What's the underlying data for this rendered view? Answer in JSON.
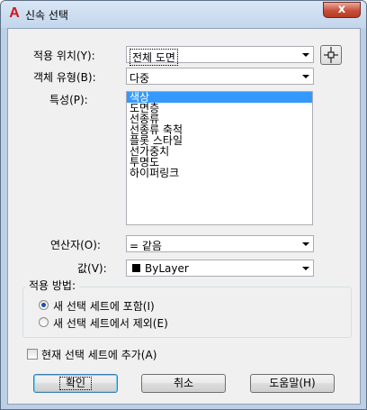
{
  "window": {
    "title": "신속 선택",
    "app_icon": "A",
    "close_label": "x"
  },
  "apply_to": {
    "label": "적용 위치(Y):",
    "value": "전체 도면"
  },
  "object_type": {
    "label": "객체 유형(B):",
    "value": "다중"
  },
  "properties": {
    "label": "특성(P):",
    "items": [
      "색상",
      "도면층",
      "선종류",
      "선종류 축척",
      "플롯 스타일",
      "선가중치",
      "투명도",
      "하이퍼링크"
    ],
    "selected_index": 0
  },
  "operator": {
    "label": "연산자(O):",
    "value": "= 같음"
  },
  "value": {
    "label": "값(V):",
    "value": "ByLayer",
    "swatch_color": "#000000"
  },
  "apply_method": {
    "title": "적용 방법:",
    "include": {
      "label": "새 선택 세트에 포함(I)",
      "checked": true
    },
    "exclude": {
      "label": "새 선택 세트에서 제외(E)",
      "checked": false
    }
  },
  "append": {
    "label": "현재 선택 세트에 추가(A)",
    "checked": false
  },
  "buttons": {
    "ok": "확인",
    "cancel": "취소",
    "help": "도움말(H)"
  },
  "colors": {
    "selection": "#3399ff",
    "close": "#c7503a"
  }
}
